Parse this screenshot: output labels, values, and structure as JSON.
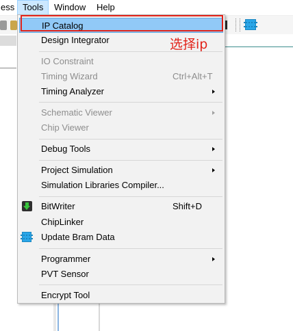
{
  "menubar": {
    "items": [
      {
        "label": "ess"
      },
      {
        "label": "Tools"
      },
      {
        "label": "Window"
      },
      {
        "label": "Help"
      }
    ]
  },
  "menu": {
    "items": [
      {
        "label": "IP Catalog"
      },
      {
        "label": "Design Integrator"
      },
      {
        "label": "IO Constraint"
      },
      {
        "label": "Timing Wizard",
        "shortcut": "Ctrl+Alt+T"
      },
      {
        "label": "Timing Analyzer"
      },
      {
        "label": "Schematic Viewer"
      },
      {
        "label": "Chip Viewer"
      },
      {
        "label": "Debug Tools"
      },
      {
        "label": "Project Simulation"
      },
      {
        "label": "Simulation Libraries Compiler..."
      },
      {
        "label": "BitWriter",
        "shortcut": "Shift+D",
        "icon": "bitwriter-icon"
      },
      {
        "label": "ChipLinker"
      },
      {
        "label": "Update Bram Data",
        "icon": "chip-icon"
      },
      {
        "label": "Programmer"
      },
      {
        "label": "PVT Sensor"
      },
      {
        "label": "Encrypt Tool"
      }
    ]
  },
  "annotation": {
    "text": "选择ip",
    "color": "#e2231a"
  },
  "colors": {
    "highlight": "#91c9f7",
    "menu_bg": "#f2f2f2",
    "active_menubar": "#cce8ff"
  }
}
